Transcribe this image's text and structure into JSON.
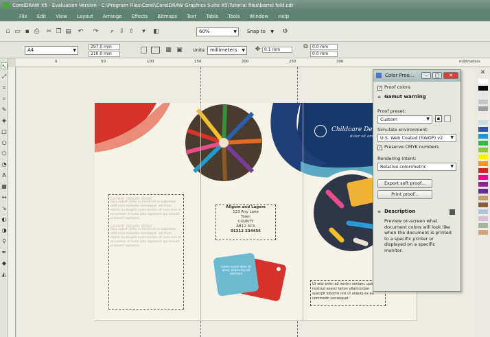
{
  "window": {
    "title": "CorelDRAW X5 - Evaluation Version - C:\\Program Files\\Corel\\CorelDRAW Graphics Suite X5\\Tutorial files\\barrel fold.cdr"
  },
  "menu": [
    "File",
    "Edit",
    "View",
    "Layout",
    "Arrange",
    "Effects",
    "Bitmaps",
    "Text",
    "Table",
    "Tools",
    "Window",
    "Help"
  ],
  "toolbar": {
    "zoom": "60%",
    "snap": "Snap to"
  },
  "property_bar": {
    "paper": "A4",
    "width": "297.0 mm",
    "height": "210.0 mm",
    "units_label": "Units:",
    "units": "millimeters",
    "nudge": "0.1 mm",
    "dup_x": "0.0 mm",
    "dup_y": "0.0 mm"
  },
  "ruler": {
    "unit": "millimeters",
    "labels": [
      "0",
      "50",
      "100",
      "150",
      "200",
      "250",
      "300"
    ]
  },
  "brochure": {
    "brand": "Childcare Delight",
    "tagline": "dolor sit amet",
    "address": [
      "Allgum and Lagers",
      "123 Any Lane",
      "Town",
      "COUNTY",
      "AB12 3CX",
      "",
      "01212 234456"
    ],
    "heading1": "Lorem ipsum dolor",
    "heading2": "Lorem ipsum dolor",
    "body": "Duis autem dolor in hendrerit in vulputate velit esse molestie consequat, vel illum dolore eu feugiat nulla facilisis at vero eros et accumsan et iusto odio dignissim qui blandit praesent luptatum.",
    "bottom_text": "Ut wisi enim ad minim veniam, quis nostrud exerci tation ullamcorper suscipit lobortis nisl ut aliquip ex ea commodo consequat.",
    "ps_text": "Lorem ipsum dolor sit amet, adipiscing elit sed diam"
  },
  "docker": {
    "title": "Color Proo...",
    "proof_colors": "Proof colors",
    "gamut_warning": "Gamut warning",
    "proof_preset_label": "Proof preset:",
    "proof_preset": "Custom",
    "simulate_label": "Simulate environment:",
    "simulate": "U.S. Web Coated (SWOP) v2",
    "preserve": "Preserve CMYK numbers",
    "rendering_label": "Rendering intent:",
    "rendering": "Relative colorimetric",
    "export_btn": "Export soft proof...",
    "print_btn": "Print proof...",
    "description_title": "Description",
    "description": "Preview on-screen what document colors will look like when the document is printed to a specific printer or displayed on a specific monitor."
  },
  "palette_colors": [
    "#ffffff",
    "#000000",
    "#e5e5e5",
    "#c8c8c8",
    "#9c9c9c",
    "#f0e8e2",
    "#c9dce8",
    "#2a56a8",
    "#1b9bd8",
    "#39b54a",
    "#8cc63f",
    "#fff200",
    "#f7941d",
    "#ed1c24",
    "#ec008c",
    "#92278f",
    "#662d91",
    "#c69c6d",
    "#8b5e3c",
    "#b0c4de",
    "#d8bfd8",
    "#a3b7a0",
    "#d2a679"
  ]
}
